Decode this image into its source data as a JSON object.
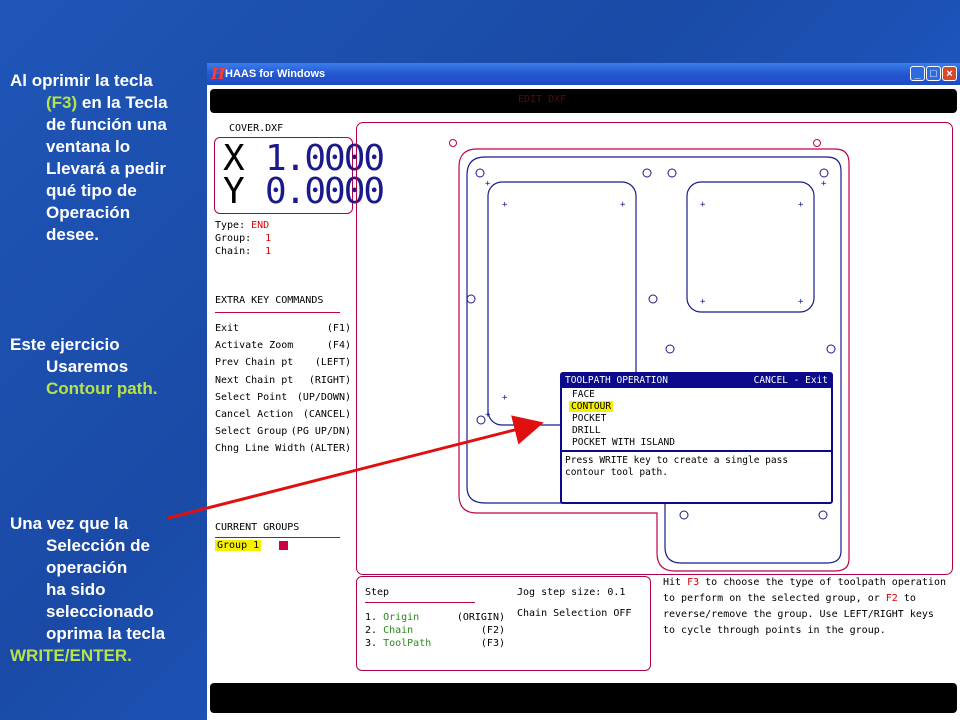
{
  "notes": {
    "block1": {
      "line1": "Al oprimir la tecla",
      "f3": "(F3)",
      "after_f3": " en la Tecla",
      "line3": "de función  una",
      "line4": "ventana lo",
      "line5": "Llevará a pedir",
      "line6": "qué tipo de",
      "line7": "Operación",
      "line8": "desee."
    },
    "block2": {
      "line1": "Este ejercicio",
      "line2": "Usaremos",
      "line3": "Contour path."
    },
    "block3": {
      "line1": "Una vez que la",
      "line2": "Selección de",
      "line3": "operación",
      "line4": "ha sido",
      "line5": "seleccionado",
      "line6": "oprima la tecla",
      "line7": "WRITE/ENTER."
    }
  },
  "window": {
    "title": "HAAS for Windows",
    "logo": "H",
    "minimize": "_",
    "maximize": "□",
    "close": "×",
    "topbar_text": "EDIT DXF"
  },
  "left_panel": {
    "filename": "COVER.DXF",
    "x_label": "X",
    "x_value": "1.0000",
    "y_label": "Y",
    "y_value": "0.0000",
    "type_label": "Type:",
    "type_value": "END",
    "group_label": "Group:",
    "group_value": "1",
    "chain_label": "Chain:",
    "chain_value": "1",
    "extra_title": "EXTRA KEY COMMANDS",
    "commands": [
      {
        "label": "Exit",
        "key": "(F1)"
      },
      {
        "label": "Activate Zoom",
        "key": "(F4)"
      },
      {
        "label": "Prev Chain pt",
        "key": "(LEFT)"
      },
      {
        "label": "Next Chain pt",
        "key": "(RIGHT)"
      },
      {
        "label": "Select Point",
        "key": "(UP/DOWN)"
      },
      {
        "label": "Cancel Action",
        "key": "(CANCEL)"
      },
      {
        "label": "Select Group",
        "key": "(PG UP/DN)"
      },
      {
        "label": "Chng Line Width",
        "key": "(ALTER)"
      }
    ],
    "groups_title": "CURRENT GROUPS",
    "group_item": "Group 1",
    "group_color": "#cc0044"
  },
  "popup": {
    "title": "TOOLPATH OPERATION",
    "cancel": "CANCEL - Exit",
    "options": [
      "FACE",
      "CONTOUR",
      "POCKET",
      "DRILL",
      "POCKET WITH ISLAND"
    ],
    "selected_index": 1,
    "help": "Press WRITE key to create a single pass contour tool path."
  },
  "step_box": {
    "step_label": "Step",
    "jog_label": "Jog step size:",
    "jog_value": "0.1",
    "chain_selection": "Chain Selection OFF",
    "steps": [
      {
        "num": "1.",
        "name": "Origin",
        "key": "(ORIGIN)"
      },
      {
        "num": "2.",
        "name": "Chain",
        "key": "(F2)"
      },
      {
        "num": "3.",
        "name": "ToolPath",
        "key": "(F3)"
      }
    ]
  },
  "help_right": {
    "l1a": "Hit ",
    "l1b": "F3",
    "l1c": " to choose the type of toolpath operation",
    "l2a": "to perform on the selected group, or ",
    "l2b": "F2",
    "l2c": " to",
    "l3": "reverse/remove the group. Use LEFT/RIGHT keys",
    "l4": "to cycle through points in the group."
  },
  "colors": {
    "accent_green": "#b7e34a",
    "drawing_red": "#c0004a",
    "drawing_blue": "#1a1a8c",
    "annotation_arrow": "#e01010",
    "selection_yellow": "#f5f000"
  }
}
